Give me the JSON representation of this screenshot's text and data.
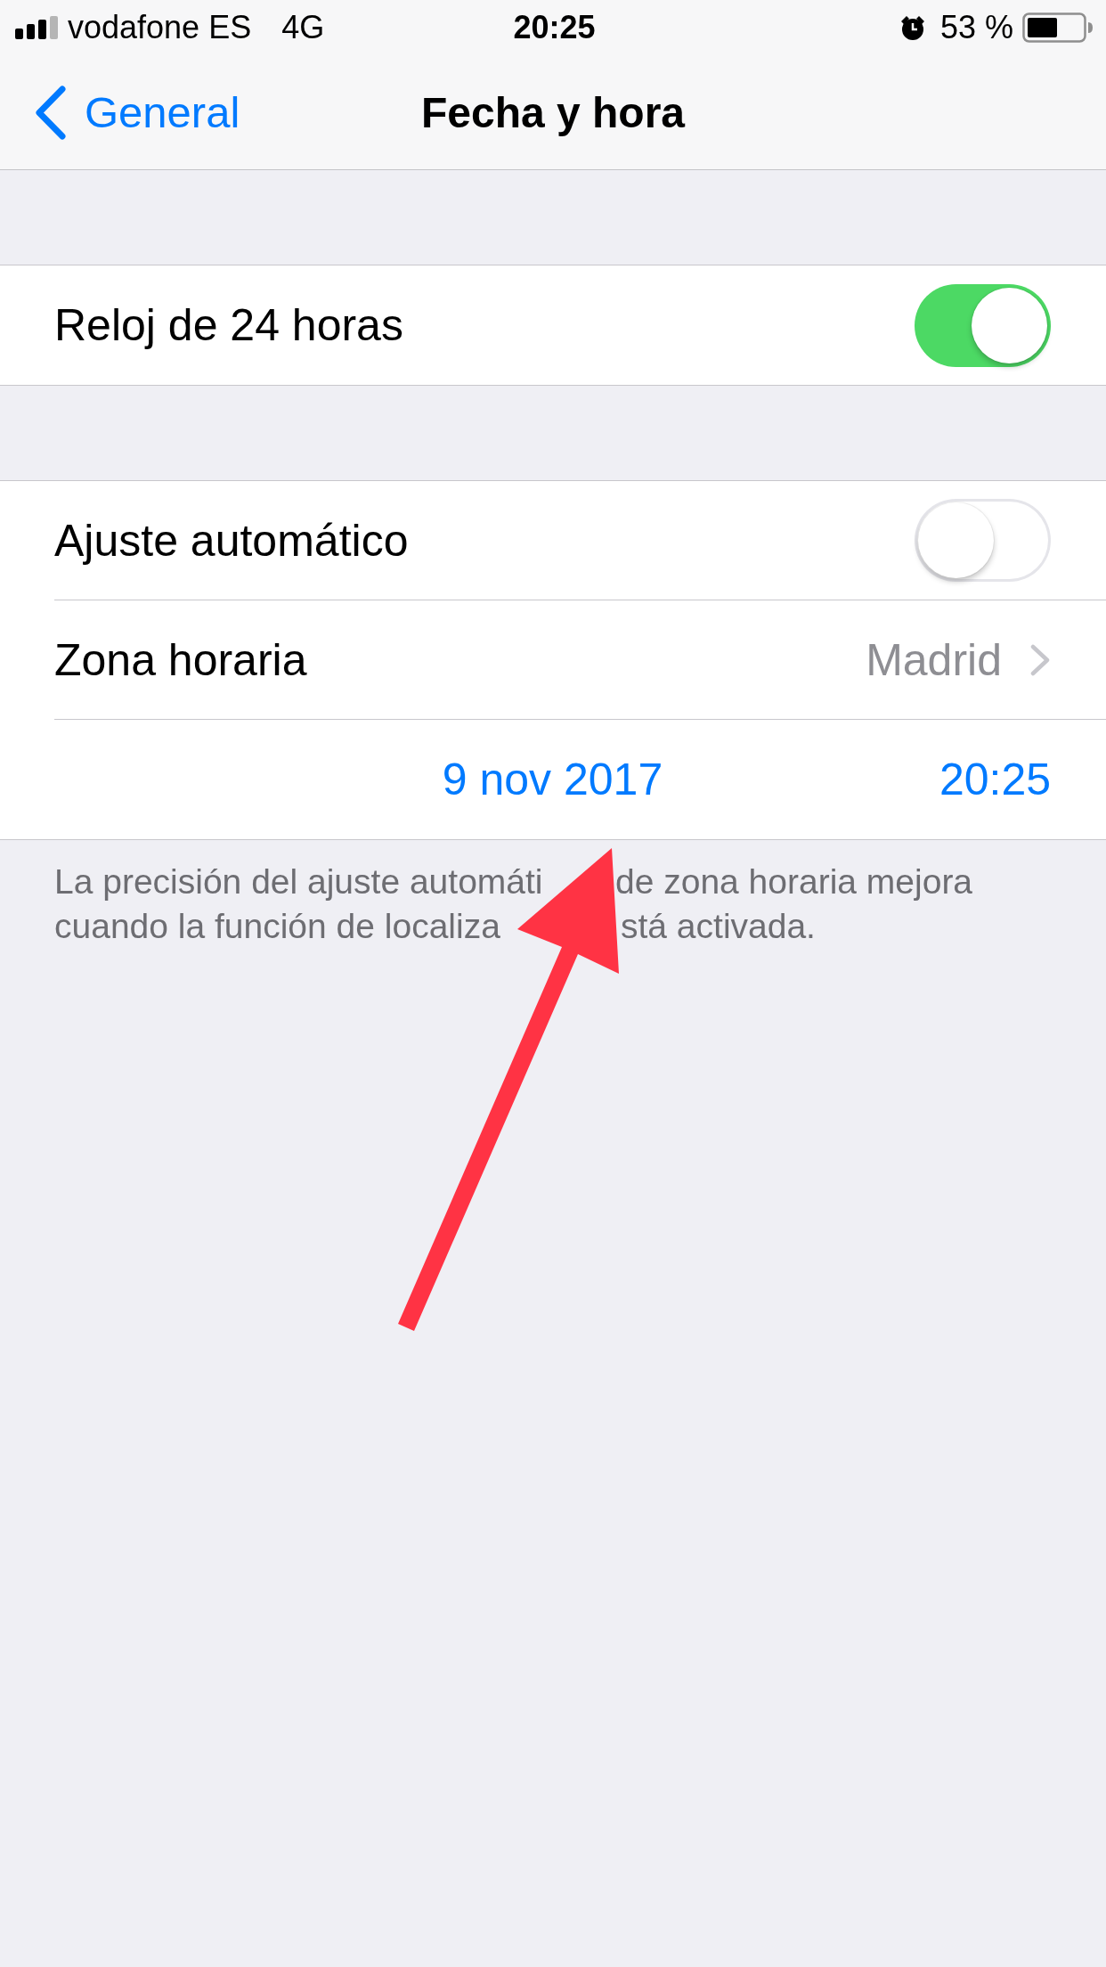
{
  "status_bar": {
    "carrier": "vodafone ES",
    "network": "4G",
    "time": "20:25",
    "battery": "53 %"
  },
  "nav_bar": {
    "back": "General",
    "title": "Fecha y hora"
  },
  "sections": [
    {
      "rows": [
        {
          "kind": "toggle",
          "label": "Reloj de 24 horas",
          "on": true
        }
      ]
    },
    {
      "rows": [
        {
          "kind": "toggle",
          "label": "Ajuste automático",
          "on": false
        },
        {
          "kind": "disclosure",
          "label": "Zona horaria",
          "value": "Madrid"
        },
        {
          "kind": "datetime",
          "date": "9 nov 2017",
          "time": "20:25"
        }
      ],
      "footer_lines": [
        [
          "La precisión del ajuste automáti",
          "de zona horaria mejora"
        ],
        [
          "cuando la función de localiza",
          "stá activada."
        ]
      ]
    }
  ]
}
